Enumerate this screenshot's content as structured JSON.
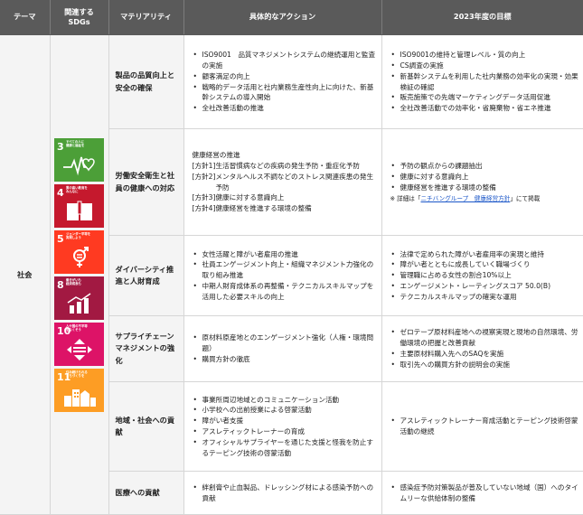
{
  "headers": {
    "theme": "テーマ",
    "sdgs": "関連する\nSDGs",
    "materiality": "マテリアリティ",
    "actions": "具体的なアクション",
    "goals": "2023年度の目標"
  },
  "theme": "社会",
  "sdg_icons": [
    {
      "number": "3",
      "title": "すべての人に\n健康と福祉を",
      "color": "#4c9f38",
      "icon": "heart-pulse-icon"
    },
    {
      "number": "4",
      "title": "質の高い教育を\nみんなに",
      "color": "#c5192d",
      "icon": "book-icon"
    },
    {
      "number": "5",
      "title": "ジェンダー平等を\n実現しよう",
      "color": "#ff3a21",
      "icon": "gender-equality-icon"
    },
    {
      "number": "8",
      "title": "働きがいも\n経済成長も",
      "color": "#a21942",
      "icon": "growth-chart-icon"
    },
    {
      "number": "10",
      "title": "人や国の不平等\nをなくそう",
      "color": "#dd1367",
      "icon": "equality-arrows-icon"
    },
    {
      "number": "11",
      "title": "住み続けられる\nまちづくりを",
      "color": "#fd9d24",
      "icon": "city-buildings-icon"
    }
  ],
  "rows": [
    {
      "materiality": "製品の品質向上と安全の確保",
      "actions": [
        "ISO9001　品質マネジメントシステムの継続運用と監査の実施",
        "顧客満足の向上",
        "戦略的データ活用と社内業務生産性向上に向けた、新基幹システムの導入開始",
        "全社改善活動の推進"
      ],
      "goals": [
        "ISO9001の維持と管理レベル・質の向上",
        "CS調査の実施",
        "新基幹システムを利用した社内業務の効率化の実現・効果検証の確認",
        "販売施策での先端マーケティングデータ活用促進",
        "全社改善活動での効率化・省廃棄物・省エネ推進"
      ]
    },
    {
      "materiality": "労働安全衛生と社員の健康への対応",
      "actions_intro": "健康経営の推進",
      "policies": [
        {
          "label": "[方針1]",
          "text": "生活習慣病などの疾病の発生予防・重症化予防"
        },
        {
          "label": "[方針2]",
          "text": "メンタルヘルス不調などのストレス関連疾患の発生予防"
        },
        {
          "label": "[方針3]",
          "text": "健康に対する意識向上"
        },
        {
          "label": "[方針4]",
          "text": "健康経営を推進する環境の整備"
        }
      ],
      "goals": [
        "予防の観点からの課題抽出",
        "健康に対する意識向上",
        "健康経営を推進する環境の整備"
      ],
      "note_prefix": "※ 詳細は「",
      "note_link": "ニチバングループ　健康経営方針",
      "note_suffix": "」にて掲載"
    },
    {
      "materiality": "ダイバーシティ推進と人財育成",
      "actions": [
        "女性活躍と障がい者雇用の推進",
        "社員エンゲージメント向上・組織マネジメント力強化の取り組み推進",
        "中期人財育成体系の再整備・テクニカルスキルマップを活用した必要スキルの向上"
      ],
      "goals": [
        "法律で定められた障がい者雇用率の実現と維持",
        "障がい者とともに成長していく職場づくり",
        "管理職に占める女性の割合10%以上",
        "エンゲージメント・レーティングスコア 50.0(B)",
        "テクニカルスキルマップの確実な運用"
      ]
    },
    {
      "materiality": "サプライチェーンマネジメントの強化",
      "actions": [
        "原材料原産地とのエンゲージメント強化（人権・環境問題）",
        "購買方針の徹底"
      ],
      "goals": [
        "ゼロテープ原材料産地への視察実現と現地の自然環境、労働環境の把握と改善貢献",
        "主要原材料購入先へのSAQを実施",
        "取引先への購買方針の説明会の実施"
      ]
    },
    {
      "materiality": "地域・社会への貢献",
      "actions": [
        "事業所周辺地域とのコミュニケーション活動",
        "小学校への出前授業による啓蒙活動",
        "障がい者支援",
        "アスレティックトレーナーの育成",
        "オフィシャルサプライヤーを通じた支援と怪我を防止するテーピング技術の啓蒙活動"
      ],
      "goals": [
        "アスレティックトレーナー育成活動とテーピング技術啓蒙活動の継続"
      ]
    },
    {
      "materiality": "医療への貢献",
      "actions": [
        "絆創膏や止血製品、ドレッシング材による感染予防への貢献"
      ],
      "goals": [
        "感染症予防対策製品が普及していない地域（国）へのタイムリーな供給体制の整備"
      ]
    }
  ]
}
